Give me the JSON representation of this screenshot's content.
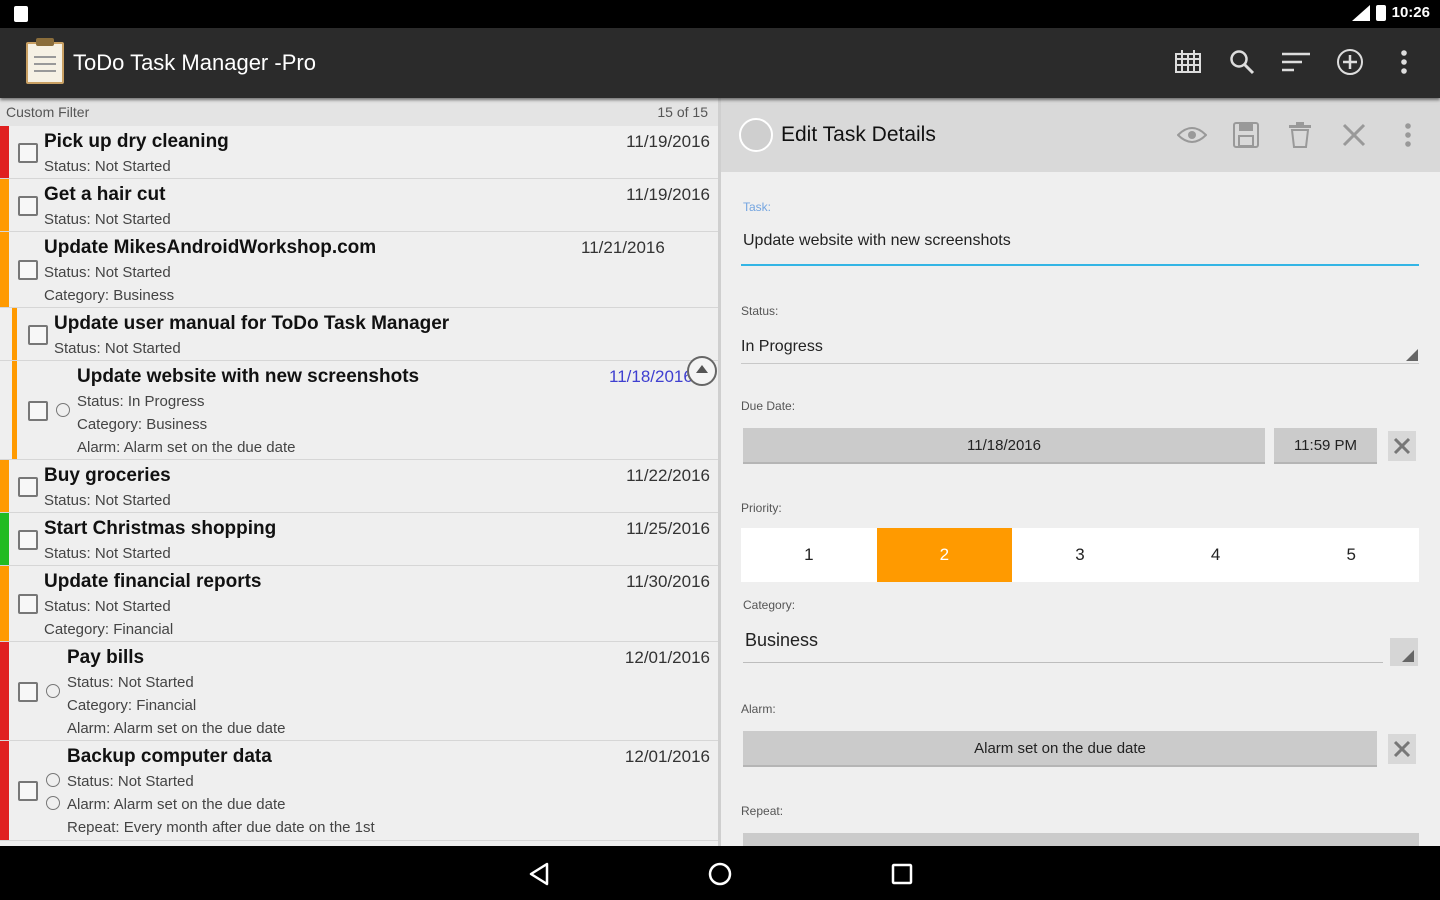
{
  "status_bar": {
    "time": "10:26"
  },
  "app": {
    "title": "ToDo Task Manager -Pro"
  },
  "toolbar": {
    "icons": [
      "calendar-grid-icon",
      "search-icon",
      "sort-icon",
      "add-icon",
      "overflow-menu-icon"
    ]
  },
  "list": {
    "filter_label": "Custom Filter",
    "count": "15 of 15",
    "tasks": [
      {
        "title": "Pick up dry cleaning",
        "date": "11/19/2016",
        "lines": [
          "Status: Not Started"
        ],
        "priority_color": "#e02020"
      },
      {
        "title": "Get a hair cut",
        "date": "11/19/2016",
        "lines": [
          "Status: Not Started"
        ],
        "priority_color": "#ff9a00"
      },
      {
        "title": "Update MikesAndroidWorkshop.com",
        "date": "11/21/2016",
        "lines": [
          "Status: Not Started",
          "Category: Business"
        ],
        "priority_color": "#ff9a00"
      },
      {
        "title": "Update user manual for ToDo Task Manager",
        "date": "",
        "lines": [
          "Status: Not Started"
        ],
        "priority_color": "#ff9a00"
      },
      {
        "title": "Update website with new screenshots",
        "date": "11/18/2016",
        "lines": [
          "Status: In Progress",
          "Category: Business",
          "Alarm: Alarm set on the due date"
        ],
        "priority_color": "#ff9a00"
      },
      {
        "title": "Buy groceries",
        "date": "11/22/2016",
        "lines": [
          "Status: Not Started"
        ],
        "priority_color": "#ff9a00"
      },
      {
        "title": "Start Christmas shopping",
        "date": "11/25/2016",
        "lines": [
          "Status: Not Started"
        ],
        "priority_color": "#22bb22"
      },
      {
        "title": "Update financial reports",
        "date": "11/30/2016",
        "lines": [
          "Status: Not Started",
          "Category: Financial"
        ],
        "priority_color": "#ff9a00"
      },
      {
        "title": "Pay bills",
        "date": "12/01/2016",
        "lines": [
          "Status: Not Started",
          "Category: Financial",
          "Alarm: Alarm set on the due date"
        ],
        "priority_color": "#e02020"
      },
      {
        "title": "Backup computer data",
        "date": "12/01/2016",
        "lines": [
          "Status: Not Started",
          "Alarm: Alarm set on the due date",
          "Repeat: Every month after due date on the 1st"
        ],
        "priority_color": "#e02020"
      }
    ]
  },
  "detail": {
    "header_title": "Edit Task Details",
    "header_icons": [
      "eye-icon",
      "save-icon",
      "delete-icon",
      "close-icon",
      "overflow-menu-icon"
    ],
    "task_label": "Task:",
    "task_value": "Update website with new screenshots",
    "status_label": "Status:",
    "status_value": "In Progress",
    "due_label": "Due Date:",
    "due_date": "11/18/2016",
    "due_time": "11:59 PM",
    "priority_label": "Priority:",
    "priority_options": [
      "1",
      "2",
      "3",
      "4",
      "5"
    ],
    "priority_selected": "2",
    "priority_accent": "#ff9a00",
    "category_label": "Category:",
    "category_value": "Business",
    "alarm_label": "Alarm:",
    "alarm_value": "Alarm set on the due date",
    "repeat_label": "Repeat:"
  }
}
